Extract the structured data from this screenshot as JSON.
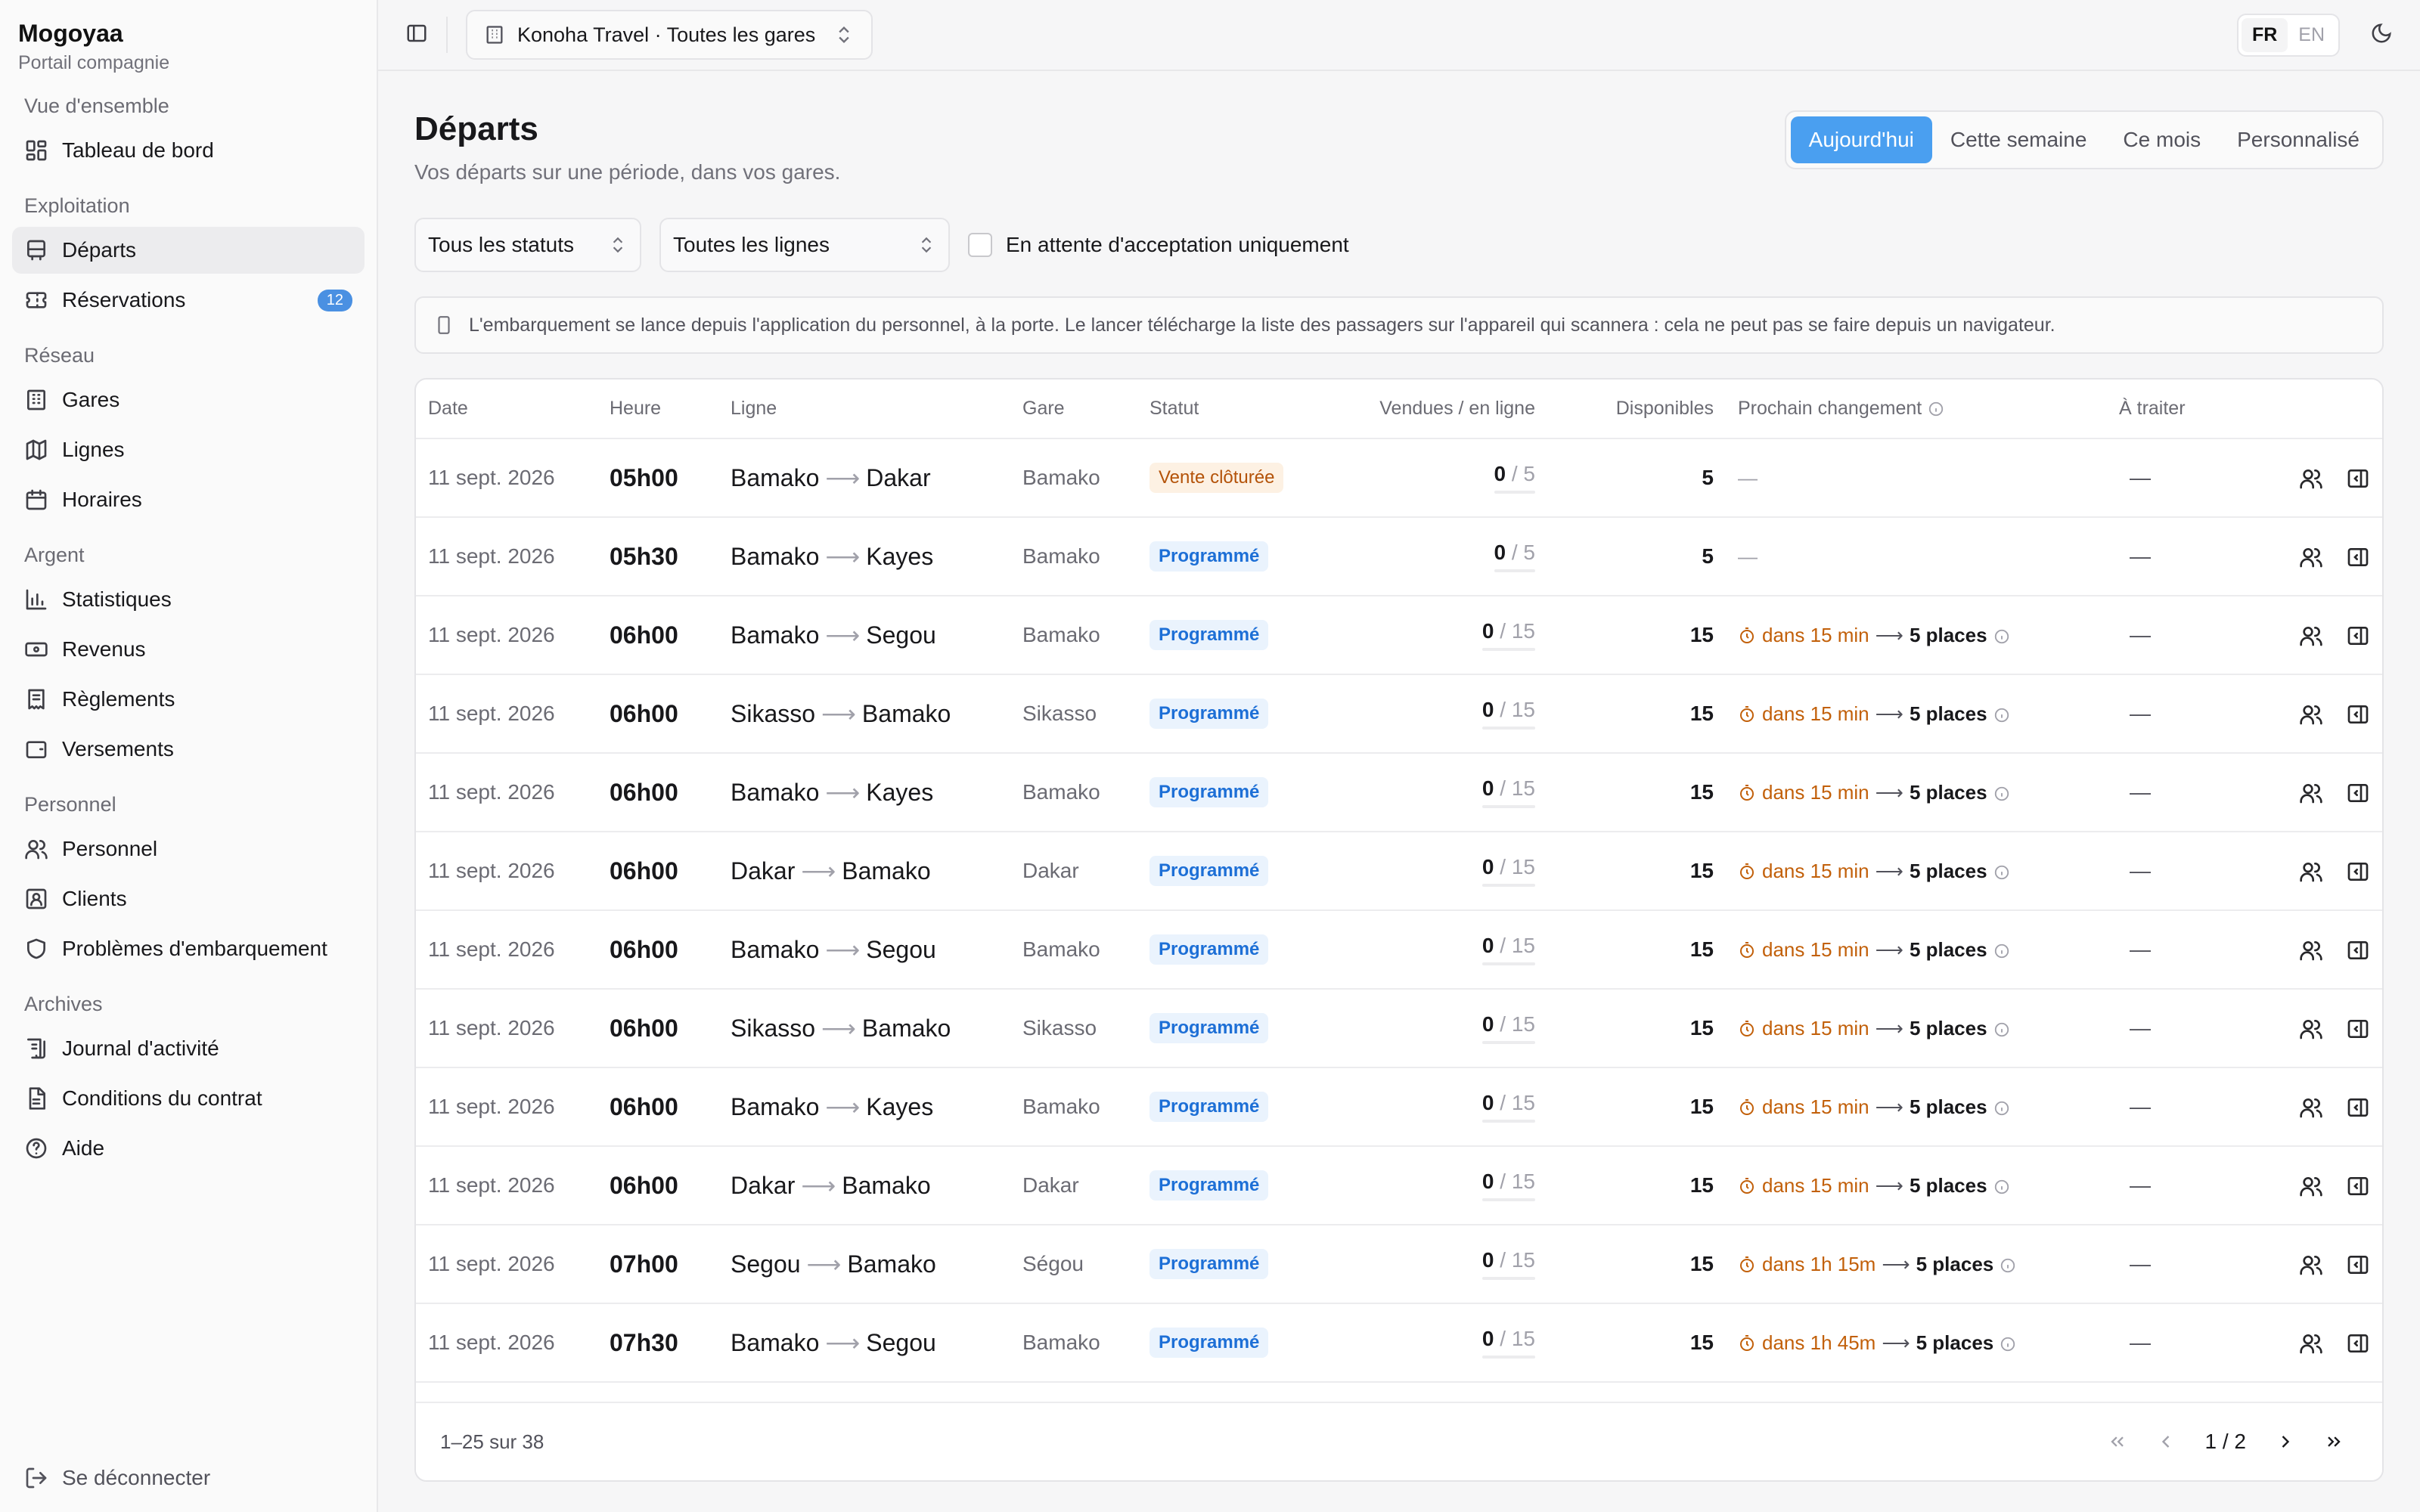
{
  "brand": {
    "name": "Mogoyaa",
    "subtitle": "Portail compagnie"
  },
  "sidebar": {
    "groups": [
      {
        "label": "Vue d'ensemble",
        "items": [
          {
            "label": "Tableau de bord",
            "icon": "dashboard-icon"
          }
        ]
      },
      {
        "label": "Exploitation",
        "items": [
          {
            "label": "Départs",
            "icon": "bus-icon",
            "active": true
          },
          {
            "label": "Réservations",
            "icon": "ticket-icon",
            "badge": "12"
          }
        ]
      },
      {
        "label": "Réseau",
        "items": [
          {
            "label": "Gares",
            "icon": "building-icon"
          },
          {
            "label": "Lignes",
            "icon": "map-icon"
          },
          {
            "label": "Horaires",
            "icon": "calendar-icon"
          }
        ]
      },
      {
        "label": "Argent",
        "items": [
          {
            "label": "Statistiques",
            "icon": "bar-chart-icon"
          },
          {
            "label": "Revenus",
            "icon": "banknote-icon"
          },
          {
            "label": "Règlements",
            "icon": "receipt-icon"
          },
          {
            "label": "Versements",
            "icon": "wallet-icon"
          }
        ]
      },
      {
        "label": "Personnel",
        "items": [
          {
            "label": "Personnel",
            "icon": "users-icon"
          },
          {
            "label": "Clients",
            "icon": "contact-icon"
          },
          {
            "label": "Problèmes d'embarquement",
            "icon": "shield-icon"
          }
        ]
      },
      {
        "label": "Archives",
        "items": [
          {
            "label": "Journal d'activité",
            "icon": "scroll-icon"
          },
          {
            "label": "Conditions du contrat",
            "icon": "document-icon"
          },
          {
            "label": "Aide",
            "icon": "help-icon"
          }
        ]
      }
    ],
    "logout_label": "Se déconnecter"
  },
  "topbar": {
    "company_select": "Konoha Travel · Toutes les gares",
    "lang_fr": "FR",
    "lang_en": "EN",
    "active_lang": "FR"
  },
  "page": {
    "title": "Départs",
    "subtitle": "Vos départs sur une période, dans vos gares.",
    "periods": [
      "Aujourd'hui",
      "Cette semaine",
      "Ce mois",
      "Personnalisé"
    ],
    "active_period": "Aujourd'hui"
  },
  "filters": {
    "status": "Tous les statuts",
    "line": "Toutes les lignes",
    "pending_only_label": "En attente d'acceptation uniquement",
    "pending_only_checked": false
  },
  "notice": "L'embarquement se lance depuis l'application du personnel, à la porte. Le lancer télécharge la liste des passagers sur l'appareil qui scannera : cela ne peut pas se faire depuis un navigateur.",
  "table": {
    "columns": [
      "Date",
      "Heure",
      "Ligne",
      "Gare",
      "Statut",
      "Vendues / en ligne",
      "Disponibles",
      "Prochain changement",
      "À traiter"
    ],
    "rows": [
      {
        "date": "11 sept. 2026",
        "time": "05h00",
        "from": "Bamako",
        "to": "Dakar",
        "gare": "Bamako",
        "status": "Vente clôturée",
        "status_kind": "closed",
        "sold": "0",
        "online": "5",
        "available": "5",
        "next_when": "",
        "next_places": "",
        "todo": "—"
      },
      {
        "date": "11 sept. 2026",
        "time": "05h30",
        "from": "Bamako",
        "to": "Kayes",
        "gare": "Bamako",
        "status": "Programmé",
        "status_kind": "prog",
        "sold": "0",
        "online": "5",
        "available": "5",
        "next_when": "",
        "next_places": "",
        "todo": "—"
      },
      {
        "date": "11 sept. 2026",
        "time": "06h00",
        "from": "Bamako",
        "to": "Segou",
        "gare": "Bamako",
        "status": "Programmé",
        "status_kind": "prog",
        "sold": "0",
        "online": "15",
        "available": "15",
        "next_when": "dans 15 min",
        "next_places": "5 places",
        "todo": "—"
      },
      {
        "date": "11 sept. 2026",
        "time": "06h00",
        "from": "Sikasso",
        "to": "Bamako",
        "gare": "Sikasso",
        "status": "Programmé",
        "status_kind": "prog",
        "sold": "0",
        "online": "15",
        "available": "15",
        "next_when": "dans 15 min",
        "next_places": "5 places",
        "todo": "—"
      },
      {
        "date": "11 sept. 2026",
        "time": "06h00",
        "from": "Bamako",
        "to": "Kayes",
        "gare": "Bamako",
        "status": "Programmé",
        "status_kind": "prog",
        "sold": "0",
        "online": "15",
        "available": "15",
        "next_when": "dans 15 min",
        "next_places": "5 places",
        "todo": "—"
      },
      {
        "date": "11 sept. 2026",
        "time": "06h00",
        "from": "Dakar",
        "to": "Bamako",
        "gare": "Dakar",
        "status": "Programmé",
        "status_kind": "prog",
        "sold": "0",
        "online": "15",
        "available": "15",
        "next_when": "dans 15 min",
        "next_places": "5 places",
        "todo": "—"
      },
      {
        "date": "11 sept. 2026",
        "time": "06h00",
        "from": "Bamako",
        "to": "Segou",
        "gare": "Bamako",
        "status": "Programmé",
        "status_kind": "prog",
        "sold": "0",
        "online": "15",
        "available": "15",
        "next_when": "dans 15 min",
        "next_places": "5 places",
        "todo": "—"
      },
      {
        "date": "11 sept. 2026",
        "time": "06h00",
        "from": "Sikasso",
        "to": "Bamako",
        "gare": "Sikasso",
        "status": "Programmé",
        "status_kind": "prog",
        "sold": "0",
        "online": "15",
        "available": "15",
        "next_when": "dans 15 min",
        "next_places": "5 places",
        "todo": "—"
      },
      {
        "date": "11 sept. 2026",
        "time": "06h00",
        "from": "Bamako",
        "to": "Kayes",
        "gare": "Bamako",
        "status": "Programmé",
        "status_kind": "prog",
        "sold": "0",
        "online": "15",
        "available": "15",
        "next_when": "dans 15 min",
        "next_places": "5 places",
        "todo": "—"
      },
      {
        "date": "11 sept. 2026",
        "time": "06h00",
        "from": "Dakar",
        "to": "Bamako",
        "gare": "Dakar",
        "status": "Programmé",
        "status_kind": "prog",
        "sold": "0",
        "online": "15",
        "available": "15",
        "next_when": "dans 15 min",
        "next_places": "5 places",
        "todo": "—"
      },
      {
        "date": "11 sept. 2026",
        "time": "07h00",
        "from": "Segou",
        "to": "Bamako",
        "gare": "Ségou",
        "status": "Programmé",
        "status_kind": "prog",
        "sold": "0",
        "online": "15",
        "available": "15",
        "next_when": "dans 1h 15m",
        "next_places": "5 places",
        "todo": "—"
      },
      {
        "date": "11 sept. 2026",
        "time": "07h30",
        "from": "Bamako",
        "to": "Segou",
        "gare": "Bamako",
        "status": "Programmé",
        "status_kind": "prog",
        "sold": "0",
        "online": "15",
        "available": "15",
        "next_when": "dans 1h 45m",
        "next_places": "5 places",
        "todo": "—"
      }
    ]
  },
  "pagination": {
    "range": "1–25 sur 38",
    "page_info": "1 / 2"
  },
  "colors": {
    "accent": "#4a9ff0",
    "badge_blue": "#1d6fd6",
    "warning": "#c2600a"
  }
}
